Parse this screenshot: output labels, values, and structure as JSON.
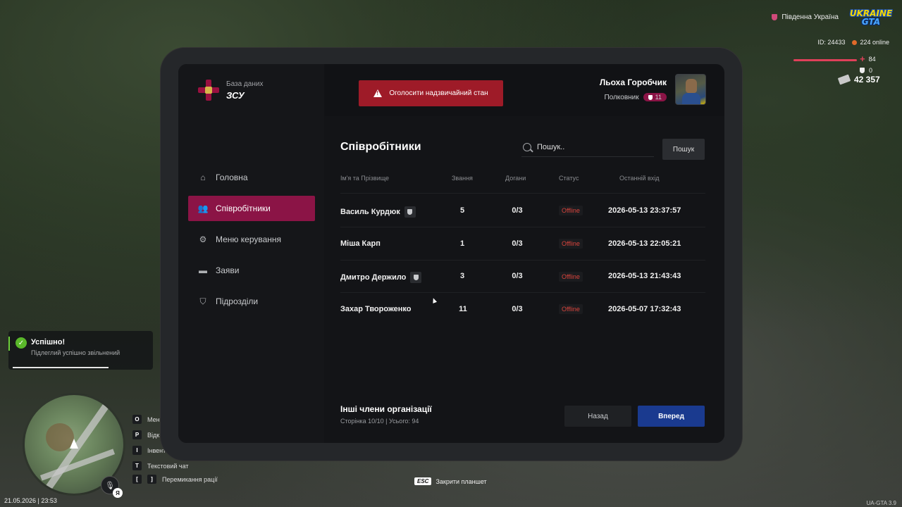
{
  "hud": {
    "server": "Південна Україна",
    "logo_line1": "UKRAINE",
    "logo_line2": "GTA",
    "id_label": "ID: 24433",
    "online": "224 online",
    "health": "84",
    "armor": "0",
    "money": "42 357"
  },
  "notification": {
    "title": "Успішно!",
    "message": "Підлеглий успішно звільнений"
  },
  "keys": [
    {
      "key": "O",
      "label": "Мені"
    },
    {
      "key": "P",
      "label": "Відк"
    },
    {
      "key": "I",
      "label": "Інвент"
    },
    {
      "key": "T",
      "label": "Текстовий чат"
    },
    {
      "key1": "[",
      "key2": "]",
      "label": "Перемикання рації"
    }
  ],
  "mic_badge": "Я",
  "datetime": "21.05.2026 | 23:53",
  "version": "UA-GTA 3.9",
  "esc": {
    "key": "ESC",
    "label": "Закрити планшет"
  },
  "tablet": {
    "brand": {
      "db": "База даних",
      "org": "ЗСУ"
    },
    "alarm_button": "Оголосити надзвичайний стан",
    "user": {
      "name": "Льоха Горобчик",
      "rank": "Полковник",
      "rank_level": "11"
    },
    "nav": [
      {
        "label": "Головна",
        "icon": "home-icon"
      },
      {
        "label": "Співробітники",
        "icon": "users-icon",
        "active": true
      },
      {
        "label": "Меню керування",
        "icon": "gear-icon"
      },
      {
        "label": "Заяви",
        "icon": "folder-icon"
      },
      {
        "label": "Підрозділи",
        "icon": "shield-icon"
      }
    ],
    "panel": {
      "title": "Співробітники",
      "search_placeholder": "Пошук..",
      "search_button": "Пошук",
      "columns": [
        "Ім'я та Прізвище",
        "Звання",
        "Догани",
        "Статус",
        "Останній вхід"
      ],
      "rows": [
        {
          "name": "Василь Курдюк",
          "badge": true,
          "rank": "5",
          "reprimands": "0/3",
          "status": "Offline",
          "last_login": "2026-05-13 23:37:57"
        },
        {
          "name": "Міша Карп",
          "badge": false,
          "rank": "1",
          "reprimands": "0/3",
          "status": "Offline",
          "last_login": "2026-05-13 22:05:21"
        },
        {
          "name": "Дмитро Держило",
          "badge": true,
          "rank": "3",
          "reprimands": "0/3",
          "status": "Offline",
          "last_login": "2026-05-13 21:43:43"
        },
        {
          "name": "Захар Твороженко",
          "badge": false,
          "rank": "11",
          "reprimands": "0/3",
          "status": "Offline",
          "last_login": "2026-05-07 17:32:43"
        }
      ],
      "footer": {
        "title": "Інші члени організації",
        "page_info": "Сторінка 10/10 | Усього: 94",
        "back": "Назад",
        "next": "Вперед"
      }
    }
  },
  "colors": {
    "accent": "#8b1446",
    "alarm": "#9e1b28",
    "primary": "#1a3a8f",
    "offline": "#d8443c"
  }
}
